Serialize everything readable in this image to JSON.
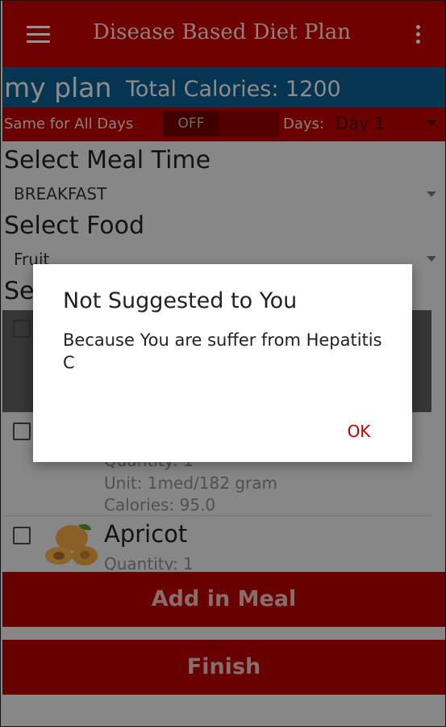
{
  "app": {
    "title": "Disease Based Diet Plan",
    "menu_icon": "hamburger-menu-icon",
    "overflow_icon": "more-vert-icon"
  },
  "plan": {
    "name": "my plan",
    "total_calories": "Total Calories: 1200"
  },
  "options": {
    "same_label": "Same for All Days",
    "toggle_state": "OFF",
    "days_label": "Days:",
    "days_value": "Day 1"
  },
  "meal_time": {
    "title": "Select Meal Time",
    "value": "BREAKFAST"
  },
  "food": {
    "title": "Select Food",
    "value": "Fruit"
  },
  "food_list": {
    "partial_header": "Se",
    "items": [
      {
        "name": "",
        "quantity": "",
        "unit": "",
        "calories": ""
      },
      {
        "name": "",
        "quantity": "Quantity: 1",
        "unit": "Unit: 1med/182 gram",
        "calories": "Calories: 95.0"
      },
      {
        "name": "Apricot",
        "quantity": "Quantity: 1",
        "unit": "",
        "calories": ""
      }
    ]
  },
  "buttons": {
    "add": "Add in Meal",
    "finish": "Finish"
  },
  "dialog": {
    "title": "Not Suggested to You",
    "message": "Because You are suffer from Hepatitis C",
    "ok": "OK"
  },
  "colors": {
    "primary": "#c00000",
    "plan_bar": "#0b5c8c",
    "accent_text": "#c00000"
  }
}
